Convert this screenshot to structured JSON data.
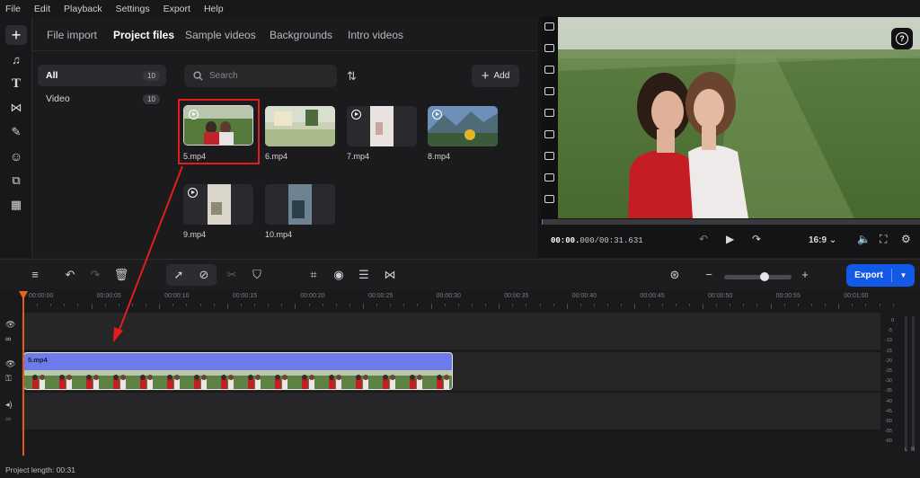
{
  "menu": [
    "File",
    "Edit",
    "Playback",
    "Settings",
    "Export",
    "Help"
  ],
  "left_toolbar": [
    "plus-icon",
    "music-note-icon",
    "text-icon",
    "transition-icon",
    "magic-wand-icon",
    "sticker-icon",
    "plugin-icon",
    "apps-icon"
  ],
  "library": {
    "tabs": [
      "File import",
      "Project files",
      "Sample videos",
      "Backgrounds",
      "Intro videos"
    ],
    "active_tab": "Project files",
    "categories": [
      {
        "label": "All",
        "count": "10"
      },
      {
        "label": "Video",
        "count": "10"
      }
    ],
    "search_placeholder": "Search",
    "add_label": "Add",
    "files": [
      "5.mp4",
      "6.mp4",
      "7.mp4",
      "8.mp4",
      "9.mp4",
      "10.mp4"
    ],
    "selected_file": "5.mp4"
  },
  "player": {
    "time_current": "00:00.",
    "time_rest": "000/00:31.631",
    "aspect": "16:9",
    "help_label": "?"
  },
  "toolbar": {
    "export_label": "Export"
  },
  "timeline": {
    "ruler": [
      "00:00:00",
      "00:00:05",
      "00:00:10",
      "00:00:15",
      "00:00:20",
      "00:00:25",
      "00:00:30",
      "00:00:35",
      "00:00:40",
      "00:00:45",
      "00:00:50",
      "00:00:55",
      "00:01:00"
    ],
    "clip_label": "5.mp4",
    "meter_labels": [
      "0",
      "-5",
      "-10",
      "-15",
      "-20",
      "-25",
      "-30",
      "-35",
      "-40",
      "-45",
      "-50",
      "-55",
      "-60"
    ],
    "meter_channels": [
      "L",
      "R"
    ],
    "project_length": "Project length: 00:31"
  },
  "colors": {
    "accent": "#1359e8",
    "selection": "#e41c1c",
    "playhead": "#e35b16",
    "clip": "#6d7bea"
  }
}
